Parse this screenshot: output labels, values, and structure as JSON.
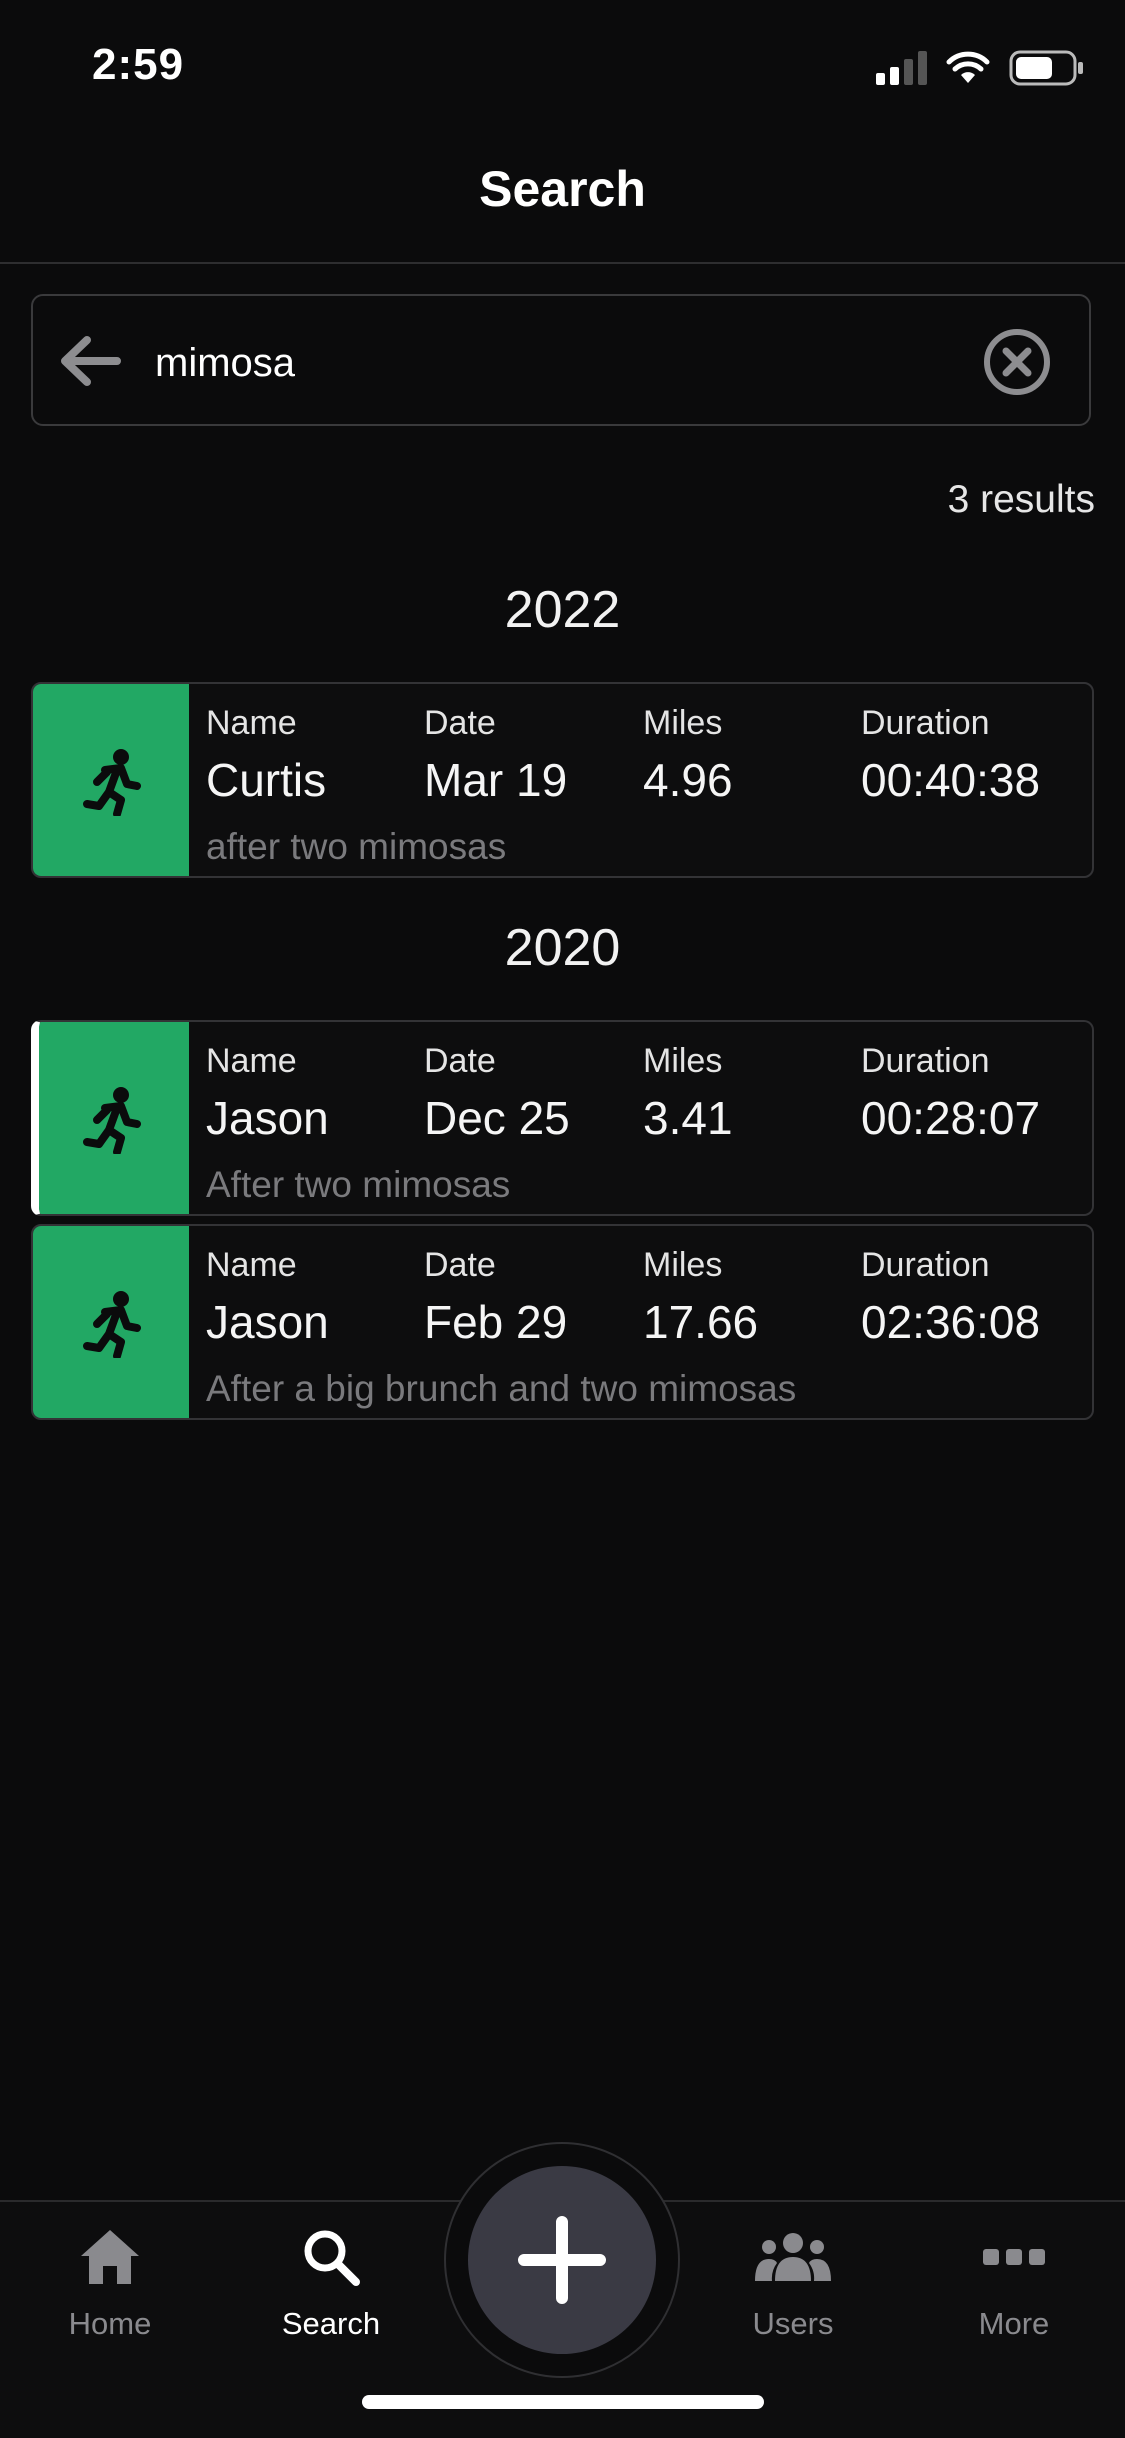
{
  "status_bar": {
    "time": "2:59"
  },
  "header": {
    "title": "Search"
  },
  "search": {
    "query": "mimosa"
  },
  "results": {
    "count_text": "3 results"
  },
  "groups": [
    {
      "year": "2022",
      "items": [
        {
          "name": "Curtis",
          "date": "Mar 19",
          "miles": "4.96",
          "duration": "00:40:38",
          "note": "after two mimosas"
        }
      ]
    },
    {
      "year": "2020",
      "items": [
        {
          "name": "Jason",
          "date": "Dec 25",
          "miles": "3.41",
          "duration": "00:28:07",
          "note": "After two mimosas"
        },
        {
          "name": "Jason",
          "date": "Feb 29",
          "miles": "17.66",
          "duration": "02:36:08",
          "note": "After a big brunch and two mimosas"
        }
      ]
    }
  ],
  "labels": {
    "name": "Name",
    "date": "Date",
    "miles": "Miles",
    "duration": "Duration"
  },
  "tabs": [
    {
      "label": "Home",
      "icon": "home-icon",
      "active": false
    },
    {
      "label": "Search",
      "icon": "search-icon",
      "active": true
    },
    {
      "label": "Users",
      "icon": "users-icon",
      "active": false
    },
    {
      "label": "More",
      "icon": "more-icon",
      "active": false
    }
  ],
  "colors": {
    "accent": "#22a864",
    "background": "#0b0b0c",
    "fab": "#3a3a44"
  }
}
